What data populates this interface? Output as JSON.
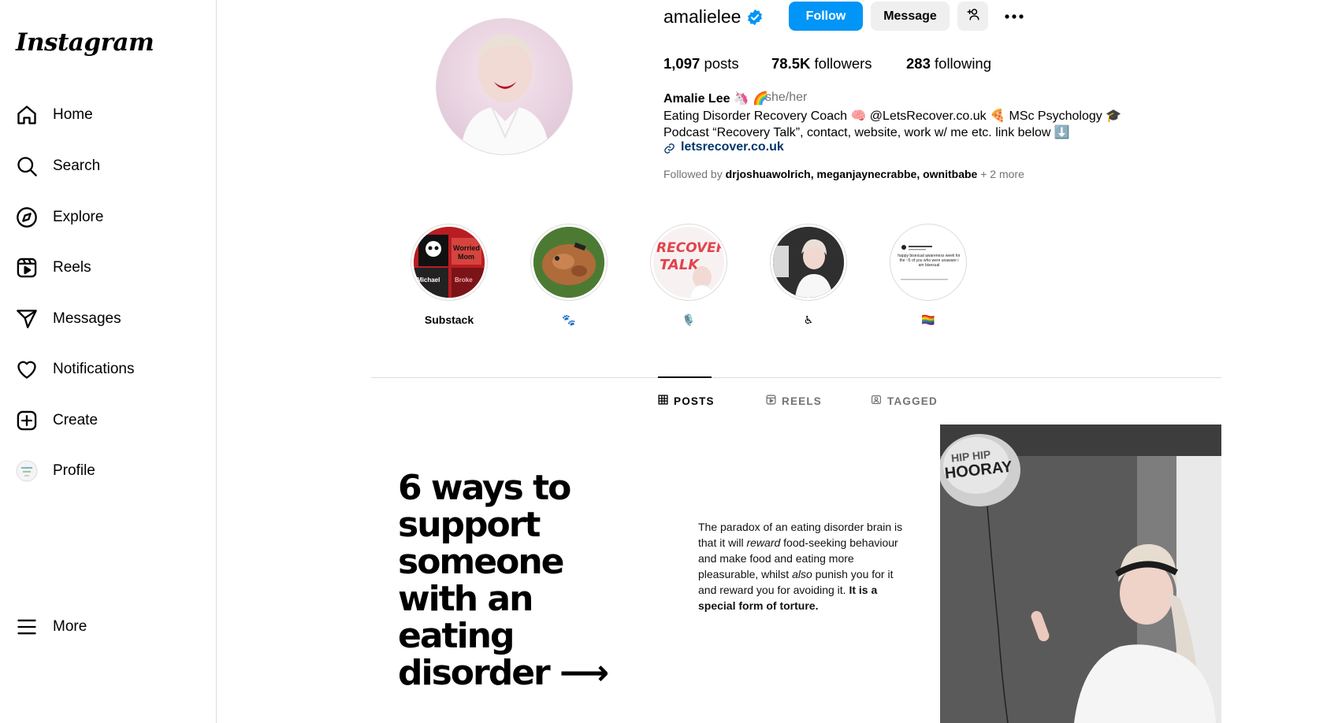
{
  "sidebar": {
    "logo": "Instagram",
    "items": [
      {
        "label": "Home",
        "icon": "home-icon"
      },
      {
        "label": "Search",
        "icon": "search-icon"
      },
      {
        "label": "Explore",
        "icon": "compass-icon"
      },
      {
        "label": "Reels",
        "icon": "reels-icon"
      },
      {
        "label": "Messages",
        "icon": "send-icon"
      },
      {
        "label": "Notifications",
        "icon": "heart-icon"
      },
      {
        "label": "Create",
        "icon": "plus-square-icon"
      },
      {
        "label": "Profile",
        "icon": "profile-avatar-icon"
      }
    ],
    "more_label": "More"
  },
  "profile": {
    "username": "amalielee",
    "follow_label": "Follow",
    "message_label": "Message",
    "stats": {
      "posts_count": "1,097",
      "posts_label": "posts",
      "followers_count": "78.5K",
      "followers_label": "followers",
      "following_count": "283",
      "following_label": "following"
    },
    "name": "Amalie Lee 🦄 🌈",
    "pronouns": "she/her",
    "bio_line1": "Eating Disorder Recovery Coach 🧠 @LetsRecover.co.uk 🍕 MSc Psychology 🎓",
    "bio_line2": "Podcast “Recovery Talk”, contact, website, work w/ me etc. link below ⬇️",
    "link": "letsrecover.co.uk",
    "followed_by_prefix": "Followed by",
    "followed_by_users": "drjoshuawolrich, meganjaynecrabbe, ownitbabe",
    "followed_by_more": "+ 2 more"
  },
  "highlights": [
    {
      "label": "Substack",
      "thumb_text_1": "Worried",
      "thumb_text_2": "Mom",
      "thumb_text_3": "Michael",
      "thumb_text_4": "Broke"
    },
    {
      "label": "🐾"
    },
    {
      "label": "🎙️",
      "thumb_text_1": "RECOVERY",
      "thumb_text_2": "TALK"
    },
    {
      "label": "♿"
    },
    {
      "label": "🏳️‍🌈",
      "thumb_text_1": "happy bisexual awareness week for the ~5 of you who were unaware i am bisexual"
    }
  ],
  "tabs": {
    "posts": "POSTS",
    "reels": "REELS",
    "tagged": "TAGGED"
  },
  "posts": {
    "post1_text": "6 ways to support someone with an eating disorder ⟶",
    "post2_part1": "The paradox of an eating disorder brain is that it will ",
    "post2_em1": "reward",
    "post2_part2": " food-seeking behaviour and make food and eating more pleasurable, whilst ",
    "post2_em2": "also",
    "post2_part3": " punish you for it and reward you for avoiding it. ",
    "post2_bold": "It is a special form of torture.",
    "post3_balloon_text": "HOORAY",
    "post3_balloon_text_top": "HIP HIP"
  },
  "colors": {
    "accent": "#0095f6",
    "link": "#00376b",
    "muted": "#737373",
    "border": "#dbdbdb",
    "verified": "#0095f6"
  }
}
